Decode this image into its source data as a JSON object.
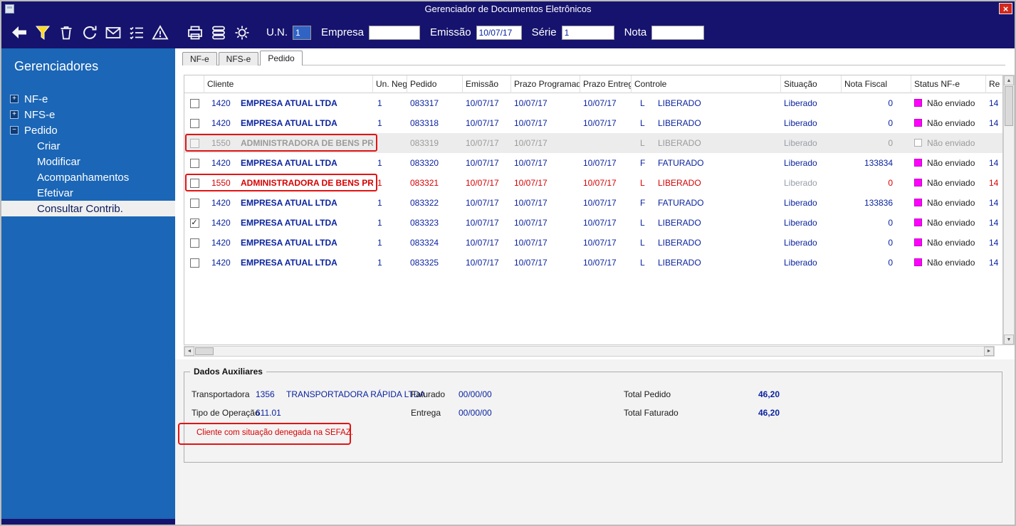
{
  "window": {
    "title": "Gerenciador de Documentos Eletrônicos"
  },
  "glyphs": {
    "close": "×",
    "up": "▲",
    "down": "▼",
    "left": "◄",
    "right": "►",
    "check": "✓"
  },
  "colors": {
    "titlebar_bg": "#16136e",
    "sidebar_bg": "#1b66b6",
    "text_navy": "#0a23a0",
    "alert_red": "#d80000",
    "annotation_red": "#e11414",
    "status_magenta": "#ff00ff",
    "selected_item_bg": "#efefef",
    "disabled_text": "#9b9b9b"
  },
  "toolbar": {
    "icons": [
      {
        "name": "back-arrow-icon"
      },
      {
        "name": "filter-icon"
      },
      {
        "name": "delete-icon"
      },
      {
        "name": "refresh-icon"
      },
      {
        "name": "email-icon"
      },
      {
        "name": "checklist-icon"
      },
      {
        "name": "warning-icon"
      },
      {
        "name": "print-icon",
        "gap": true
      },
      {
        "name": "stack-icon"
      },
      {
        "name": "settings-icon"
      }
    ],
    "fields": [
      {
        "name": "un",
        "label": "U.N.",
        "value": "1",
        "selected": true
      },
      {
        "name": "empresa",
        "label": "Empresa",
        "value": ""
      },
      {
        "name": "emissao",
        "label": "Emissão",
        "value": "10/07/17"
      },
      {
        "name": "serie",
        "label": "Série",
        "value": "1"
      },
      {
        "name": "nota",
        "label": "Nota",
        "value": ""
      }
    ]
  },
  "sidebar": {
    "title": "Gerenciadores",
    "items": [
      {
        "label": "NF-e",
        "level": 0,
        "expander": "+"
      },
      {
        "label": "NFS-e",
        "level": 0,
        "expander": "+"
      },
      {
        "label": "Pedido",
        "level": 0,
        "expander": "−"
      },
      {
        "label": "Criar",
        "level": 1
      },
      {
        "label": "Modificar",
        "level": 1
      },
      {
        "label": "Acompanhamentos",
        "level": 1
      },
      {
        "label": "Efetivar",
        "level": 1
      },
      {
        "label": "Consultar Contrib.",
        "level": 1,
        "selected": true
      }
    ]
  },
  "tabs": [
    {
      "label": "NF-e"
    },
    {
      "label": "NFS-e"
    },
    {
      "label": "Pedido",
      "active": true
    }
  ],
  "table": {
    "columns": [
      {
        "key": "sel",
        "label": ""
      },
      {
        "key": "cliente",
        "label": "Cliente"
      },
      {
        "key": "un",
        "label": "Un. Neg."
      },
      {
        "key": "pedido",
        "label": "Pedido"
      },
      {
        "key": "emissao",
        "label": "Emissão"
      },
      {
        "key": "prazo_prog",
        "label": "Prazo Programado"
      },
      {
        "key": "prazo_ent",
        "label": "Prazo Entrega"
      },
      {
        "key": "controle",
        "label": "Controle"
      },
      {
        "key": "situacao",
        "label": "Situação"
      },
      {
        "key": "nota",
        "label": "Nota Fiscal"
      },
      {
        "key": "status",
        "label": "Status NF-e"
      },
      {
        "key": "re",
        "label": "Re"
      }
    ],
    "rows": [
      {
        "checked": false,
        "state": "normal",
        "highlight": false,
        "cliente_code": "1420",
        "cliente_name": "EMPRESA ATUAL LTDA",
        "un": "1",
        "pedido": "083317",
        "emissao": "10/07/17",
        "prazo_prog": "10/07/17",
        "prazo_ent": "10/07/17",
        "controle_code": "L",
        "controle": "LIBERADO",
        "situacao": "Liberado",
        "situacao_muted": false,
        "nota": "0",
        "status": "Não enviado",
        "re": "14"
      },
      {
        "checked": false,
        "state": "normal",
        "highlight": false,
        "cliente_code": "1420",
        "cliente_name": "EMPRESA ATUAL LTDA",
        "un": "1",
        "pedido": "083318",
        "emissao": "10/07/17",
        "prazo_prog": "10/07/17",
        "prazo_ent": "10/07/17",
        "controle_code": "L",
        "controle": "LIBERADO",
        "situacao": "Liberado",
        "situacao_muted": false,
        "nota": "0",
        "status": "Não enviado",
        "re": "14"
      },
      {
        "checked": false,
        "state": "disabled",
        "highlight": true,
        "cliente_code": "1550",
        "cliente_name": "ADMINISTRADORA DE BENS PRÓPRI",
        "un": "",
        "pedido": "083319",
        "emissao": "10/07/17",
        "prazo_prog": "10/07/17",
        "prazo_ent": "",
        "controle_code": "L",
        "controle": "LIBERADO",
        "situacao": "Liberado",
        "situacao_muted": true,
        "nota": "0",
        "status": "Não enviado",
        "re": ""
      },
      {
        "checked": false,
        "state": "normal",
        "highlight": false,
        "cliente_code": "1420",
        "cliente_name": "EMPRESA ATUAL LTDA",
        "un": "1",
        "pedido": "083320",
        "emissao": "10/07/17",
        "prazo_prog": "10/07/17",
        "prazo_ent": "10/07/17",
        "controle_code": "F",
        "controle": "FATURADO",
        "situacao": "Liberado",
        "situacao_muted": false,
        "nota": "133834",
        "status": "Não enviado",
        "re": "14"
      },
      {
        "checked": false,
        "state": "alert",
        "highlight": true,
        "cliente_code": "1550",
        "cliente_name": "ADMINISTRADORA DE BENS PRÓPRI",
        "un": "1",
        "pedido": "083321",
        "emissao": "10/07/17",
        "prazo_prog": "10/07/17",
        "prazo_ent": "10/07/17",
        "controle_code": "L",
        "controle": "LIBERADO",
        "situacao": "Liberado",
        "situacao_muted": true,
        "nota": "0",
        "status": "Não enviado",
        "re": "14"
      },
      {
        "checked": false,
        "state": "normal",
        "highlight": false,
        "cliente_code": "1420",
        "cliente_name": "EMPRESA ATUAL LTDA",
        "un": "1",
        "pedido": "083322",
        "emissao": "10/07/17",
        "prazo_prog": "10/07/17",
        "prazo_ent": "10/07/17",
        "controle_code": "F",
        "controle": "FATURADO",
        "situacao": "Liberado",
        "situacao_muted": false,
        "nota": "133836",
        "status": "Não enviado",
        "re": "14"
      },
      {
        "checked": true,
        "state": "normal",
        "highlight": false,
        "cliente_code": "1420",
        "cliente_name": "EMPRESA ATUAL LTDA",
        "un": "1",
        "pedido": "083323",
        "emissao": "10/07/17",
        "prazo_prog": "10/07/17",
        "prazo_ent": "10/07/17",
        "controle_code": "L",
        "controle": "LIBERADO",
        "situacao": "Liberado",
        "situacao_muted": false,
        "nota": "0",
        "status": "Não enviado",
        "re": "14"
      },
      {
        "checked": false,
        "state": "normal",
        "highlight": false,
        "cliente_code": "1420",
        "cliente_name": "EMPRESA ATUAL LTDA",
        "un": "1",
        "pedido": "083324",
        "emissao": "10/07/17",
        "prazo_prog": "10/07/17",
        "prazo_ent": "10/07/17",
        "controle_code": "L",
        "controle": "LIBERADO",
        "situacao": "Liberado",
        "situacao_muted": false,
        "nota": "0",
        "status": "Não enviado",
        "re": "14"
      },
      {
        "checked": false,
        "state": "normal",
        "highlight": false,
        "cliente_code": "1420",
        "cliente_name": "EMPRESA ATUAL LTDA",
        "un": "1",
        "pedido": "083325",
        "emissao": "10/07/17",
        "prazo_prog": "10/07/17",
        "prazo_ent": "10/07/17",
        "controle_code": "L",
        "controle": "LIBERADO",
        "situacao": "Liberado",
        "situacao_muted": false,
        "nota": "0",
        "status": "Não enviado",
        "re": "14"
      }
    ]
  },
  "aux": {
    "title": "Dados Auxiliares",
    "transportadora_label": "Transportadora",
    "transportadora_code": "1356",
    "transportadora_name": "TRANSPORTADORA RÁPIDA LTDA",
    "tipo_operacao_label": "Tipo de Operação",
    "tipo_operacao_value": "611.01",
    "faturado_label": "Faturado",
    "faturado_value": "00/00/00",
    "entrega_label": "Entrega",
    "entrega_value": "00/00/00",
    "total_pedido_label": "Total Pedido",
    "total_pedido_value": "46,20",
    "total_faturado_label": "Total Faturado",
    "total_faturado_value": "46,20",
    "warning": "Cliente com situação denegada na SEFAZ."
  }
}
